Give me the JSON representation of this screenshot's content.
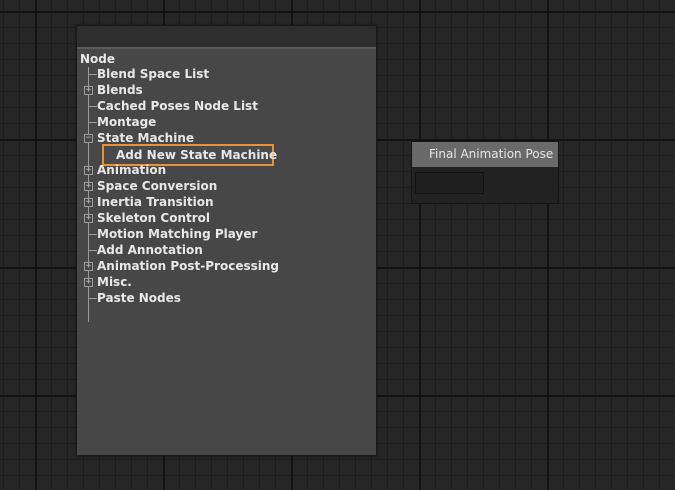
{
  "result_node": {
    "title": "Final Animation Pose"
  },
  "menu": {
    "root_label": "Node",
    "items": [
      {
        "label": "Blend Space List",
        "expandable": false
      },
      {
        "label": "Blends",
        "expandable": true
      },
      {
        "label": "Cached Poses Node List",
        "expandable": false
      },
      {
        "label": "Montage",
        "expandable": false
      },
      {
        "label": "State Machine",
        "expandable": true,
        "expanded": true
      },
      {
        "label": "Animation",
        "expandable": true
      },
      {
        "label": "Space Conversion",
        "expandable": true
      },
      {
        "label": "Inertia Transition",
        "expandable": true
      },
      {
        "label": "Skeleton Control",
        "expandable": true
      },
      {
        "label": "Motion Matching Player",
        "expandable": false
      },
      {
        "label": "Add Annotation",
        "expandable": false
      },
      {
        "label": "Animation Post-Processing",
        "expandable": true
      },
      {
        "label": "Misc.",
        "expandable": true
      },
      {
        "label": "Paste Nodes",
        "expandable": false
      }
    ],
    "state_machine_children": [
      {
        "label": "Add New State Machine",
        "highlighted": true
      }
    ]
  },
  "colors": {
    "canvas_bg": "#262626",
    "menu_bg": "#474747",
    "highlight_border": "#e8903a",
    "node_title_bg": "#6a6a6a"
  }
}
